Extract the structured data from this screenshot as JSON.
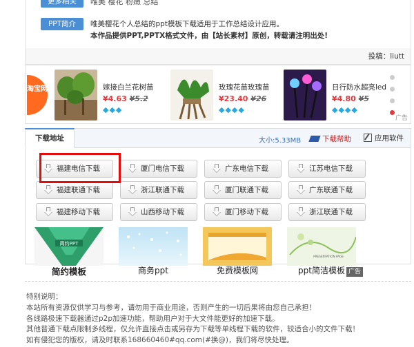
{
  "info": {
    "more_tag": "更多相关",
    "more_text": "唯美  樱花  粉嫩  总结",
    "ppt_tag": "PPT简介",
    "line1": "唯美樱花个人总结的ppt模板下载适用于工作总结设计应用。",
    "line2": "本作品提供PPT,PPTX格式文件，由【站长素材】原创，转载请注明出处!",
    "uploader": "投稿：liutt"
  },
  "ads": {
    "taobao_label": "淘宝网",
    "items": [
      {
        "name": "嫁接白兰花树苗",
        "price": "¥4.63",
        "old": "¥5.2",
        "gems": "◆◆◆"
      },
      {
        "name": "玫瑰花苗玫瑰苗",
        "price": "¥23.40",
        "old": "¥26",
        "gems": "◆◆◆◆"
      },
      {
        "name": "日行防水超亮led",
        "price": "¥4.80",
        "old": "¥5",
        "gems": "◆◆◆◆"
      }
    ],
    "ad_label": "广告"
  },
  "download": {
    "tab": "下载地址",
    "size": "大小:5.33MB",
    "help": "下载帮助",
    "software": "应用软件",
    "buttons": [
      [
        "福建电信下载",
        "厦门电信下载",
        "广东电信下载",
        "江苏电信下载"
      ],
      [
        "福建联通下载",
        "浙江联通下载",
        "厦门联通下载",
        "广东联通下载"
      ],
      [
        "福建移动下载",
        "山西移动下载",
        "厦门移动下载",
        "浙江联通下载"
      ]
    ]
  },
  "templates": {
    "items": [
      {
        "caption": "简约模板",
        "bold": true,
        "img_text": "简约PPT"
      },
      {
        "caption": "商务ppt",
        "bold": false,
        "img_text": ""
      },
      {
        "caption": "免费模板网",
        "bold": false,
        "img_text": ""
      },
      {
        "caption": "ppt简洁模板",
        "bold": false,
        "img_text": "PRESENTATION PAGE"
      }
    ],
    "ad_label": "广告"
  },
  "notes": {
    "title": "特别说明：",
    "lines": [
      "本站所有资源仅供学习与参考，请勿用于商业用途，否则产生的一切后果将由您自己承担！",
      "各线路极速下载器通过p2p加速功能，帮助用户对于大文件能更好的加速下载。",
      "其他普通下载点限制多线程，仅允许直接点击或另存为下载等单线程下载的软件，较适合小的文件下载！",
      "如有侵犯您的版权，请及时联系168660460#qq.com(#换@)，我们将尽快处理。"
    ]
  },
  "colors": {
    "accent": "#4a8ed6",
    "highlight": "#e20c0c",
    "price": "#e4393c",
    "taobao": "#ff6a1f"
  }
}
